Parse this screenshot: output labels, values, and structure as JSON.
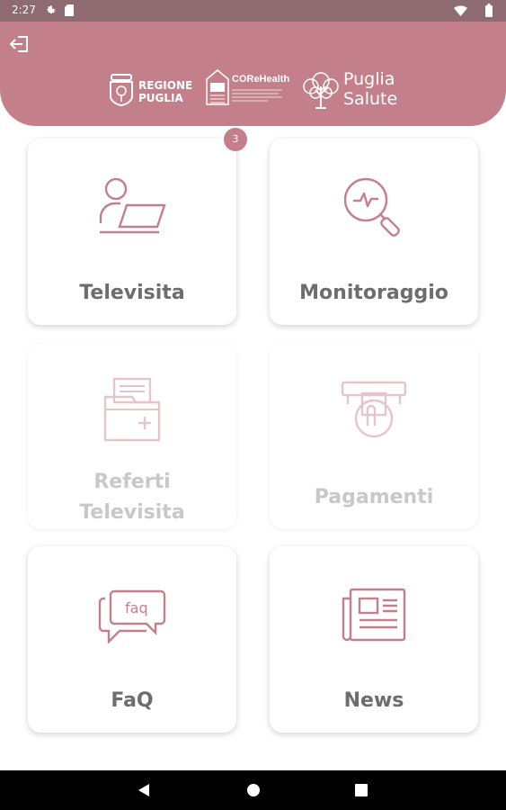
{
  "status_bar": {
    "time": "2:27",
    "icons": [
      "settings-icon",
      "sd-card-icon",
      "wifi-icon",
      "battery-icon"
    ]
  },
  "header": {
    "background": "#c3808b",
    "logos": {
      "regione": "REGIONE\nPUGLIA",
      "core": "COReHealth",
      "puglia": "Puglia\nSalute"
    }
  },
  "accent_color": "#c3808b",
  "cards": [
    {
      "label": "Televisita",
      "icon": "person-laptop-icon",
      "badge": "3",
      "enabled": true
    },
    {
      "label": "Monitoraggio",
      "icon": "magnifier-heartbeat-icon",
      "enabled": true
    },
    {
      "label": "Referti\nTelevisita",
      "icon": "folder-documents-icon",
      "enabled": false
    },
    {
      "label": "Pagamenti",
      "icon": "card-payment-icon",
      "enabled": false
    },
    {
      "label": "FaQ",
      "icon": "faq-chat-icon",
      "enabled": true
    },
    {
      "label": "News",
      "icon": "newspaper-icon",
      "enabled": true
    }
  ],
  "nav_bar": {
    "buttons": [
      "back-icon",
      "home-icon",
      "recents-icon"
    ]
  }
}
